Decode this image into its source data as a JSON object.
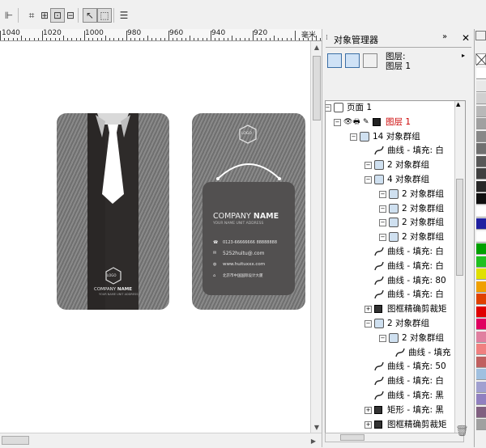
{
  "ruler": {
    "labels": [
      "1040",
      "1020",
      "1000",
      "980",
      "960",
      "940",
      "920"
    ],
    "unit": "毫米"
  },
  "panel": {
    "title": "对象管理器",
    "layer_info_line1": "图层:",
    "layer_info_line2": "图层 1",
    "tree": [
      {
        "label": "页面 1"
      },
      {
        "label": "图层 1",
        "color": "#cc0000"
      },
      {
        "label": "14 对象群组"
      },
      {
        "label": "曲线 - 填充: 白"
      },
      {
        "label": "2 对象群组"
      },
      {
        "label": "4 对象群组"
      },
      {
        "label": "2 对象群组"
      },
      {
        "label": "2 对象群组"
      },
      {
        "label": "2 对象群组"
      },
      {
        "label": "2 对象群组"
      },
      {
        "label": "曲线 - 填充: 白"
      },
      {
        "label": "曲线 - 填充: 白"
      },
      {
        "label": "曲线 - 填充: 80"
      },
      {
        "label": "曲线 - 填充: 白"
      },
      {
        "label": "图框精确剪裁矩"
      },
      {
        "label": "2 对象群组"
      },
      {
        "label": "2 对象群组"
      },
      {
        "label": "曲线 - 填充"
      },
      {
        "label": "曲线 - 填充: 50"
      },
      {
        "label": "曲线 - 填充: 白"
      },
      {
        "label": "曲线 - 填充: 黑"
      },
      {
        "label": "矩形 - 填充: 黑"
      },
      {
        "label": "图框精确剪裁矩"
      }
    ]
  },
  "card_front": {
    "logo": "LOGO",
    "company": "COMPANY",
    "company_bold": "NAME",
    "tagline": "YOUR NAME UNIT ADDRESS"
  },
  "card_back": {
    "logo": "LOGO",
    "company": "COMPANY",
    "company_bold": "NAME",
    "tagline": "YOUR NAME UNIT ADDRESS",
    "phone": "0123-66666666 88888888",
    "email": "5252huitu@.com",
    "web": "www.huituxxx.com",
    "address": "北京市中国国际设计大厦"
  },
  "palette": [
    "#ffffff",
    "#e8e8e8",
    "#d0d0d0",
    "#b8b8b8",
    "#a0a0a0",
    "#888888",
    "#707070",
    "#585858",
    "#404040",
    "#282828",
    "#101010",
    "#ffffff",
    "#2020a0",
    "#ffffff",
    "#00a000",
    "#20c020",
    "#e0e000",
    "#f0a000",
    "#e04000",
    "#e00000",
    "#e00060",
    "#e080a0",
    "#f08080",
    "#c06060",
    "#a0c0e0",
    "#a0a0d0",
    "#9080c0",
    "#806080",
    "#a0a0a0"
  ]
}
